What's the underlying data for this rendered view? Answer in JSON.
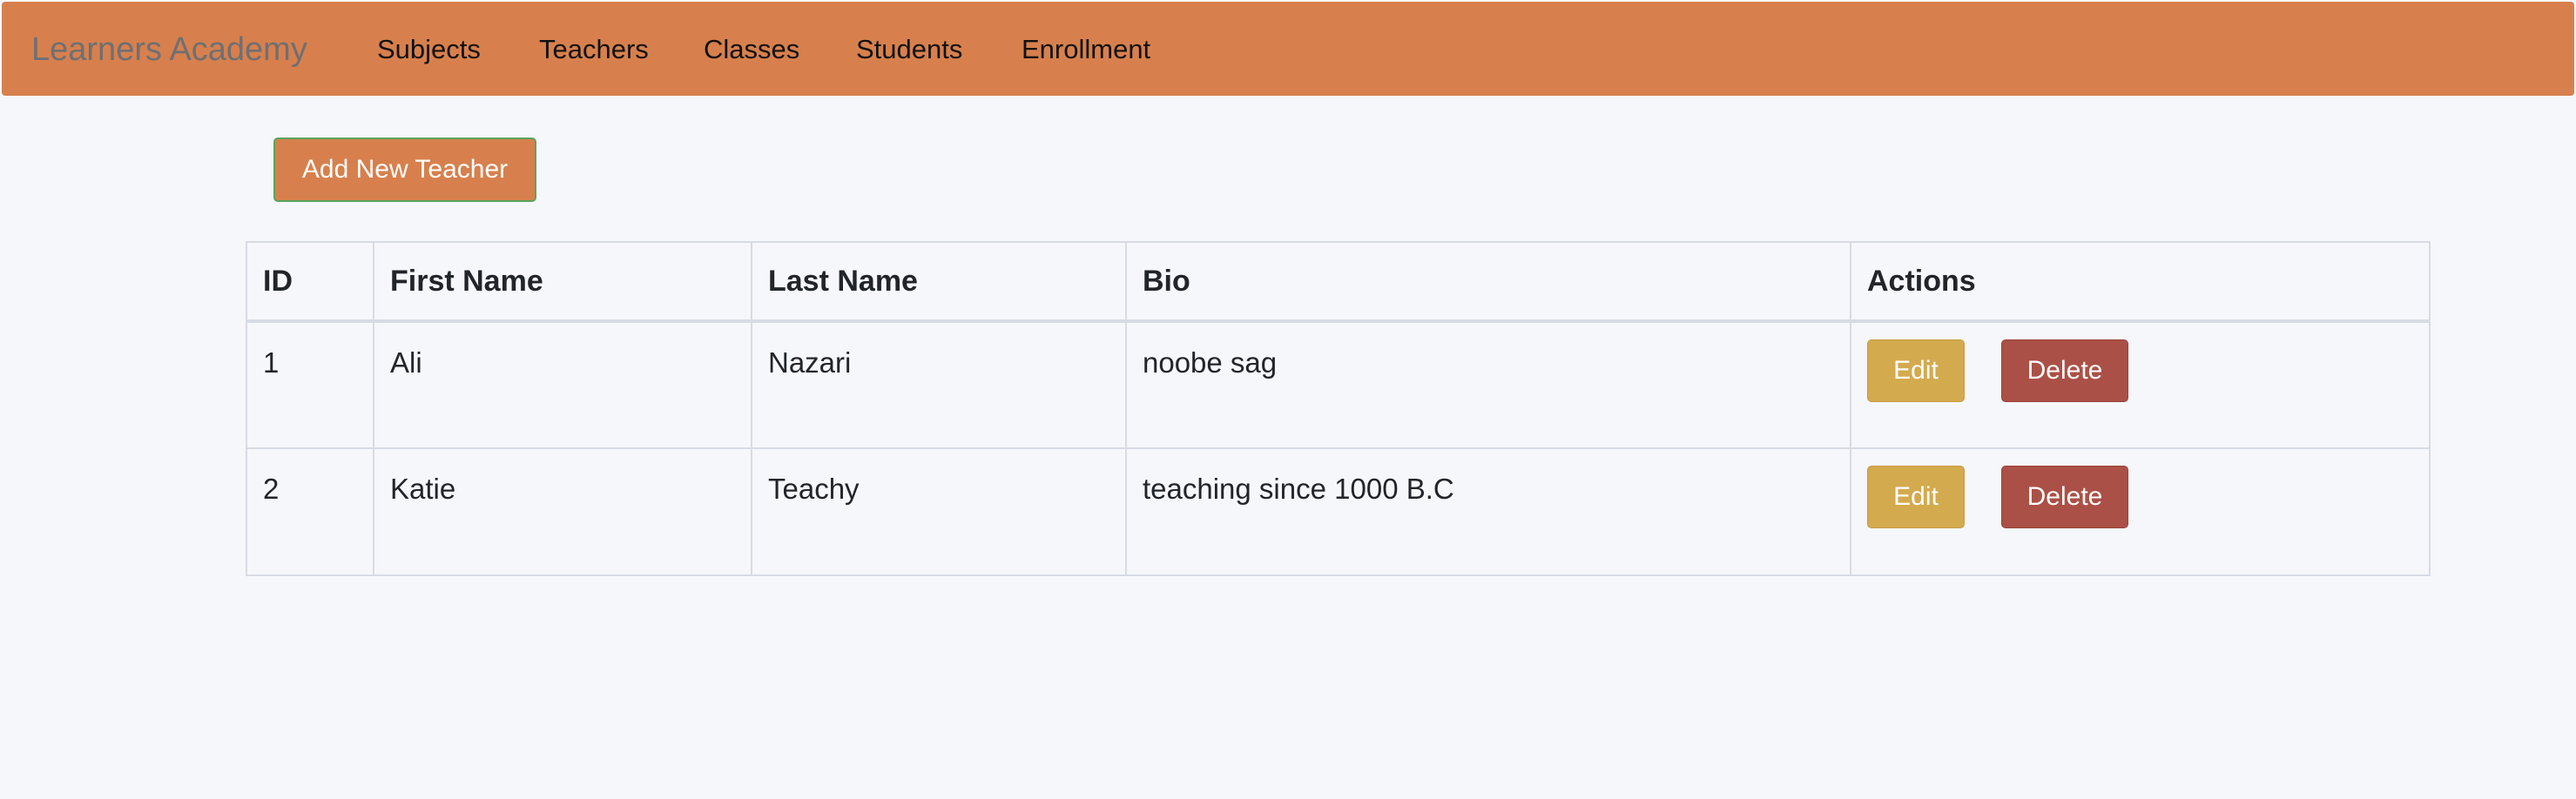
{
  "navbar": {
    "brand": "Learners Academy",
    "items": [
      {
        "label": "Subjects"
      },
      {
        "label": "Teachers"
      },
      {
        "label": "Classes"
      },
      {
        "label": "Students"
      },
      {
        "label": "Enrollment"
      }
    ],
    "background_color": "#d7804d"
  },
  "toolbar": {
    "add_label": "Add New Teacher"
  },
  "table": {
    "headers": [
      "ID",
      "First Name",
      "Last Name",
      "Bio",
      "Actions"
    ],
    "rows": [
      {
        "id": "1",
        "first_name": "Ali",
        "last_name": "Nazari",
        "bio": "noobe sag",
        "edit_label": "Edit",
        "delete_label": "Delete"
      },
      {
        "id": "2",
        "first_name": "Katie",
        "last_name": "Teachy",
        "bio": "teaching since 1000 B.C",
        "edit_label": "Edit",
        "delete_label": "Delete"
      }
    ]
  },
  "colors": {
    "edit_button": "#d4aa4f",
    "delete_button": "#ab5046",
    "page_background": "#f6f7fb"
  }
}
